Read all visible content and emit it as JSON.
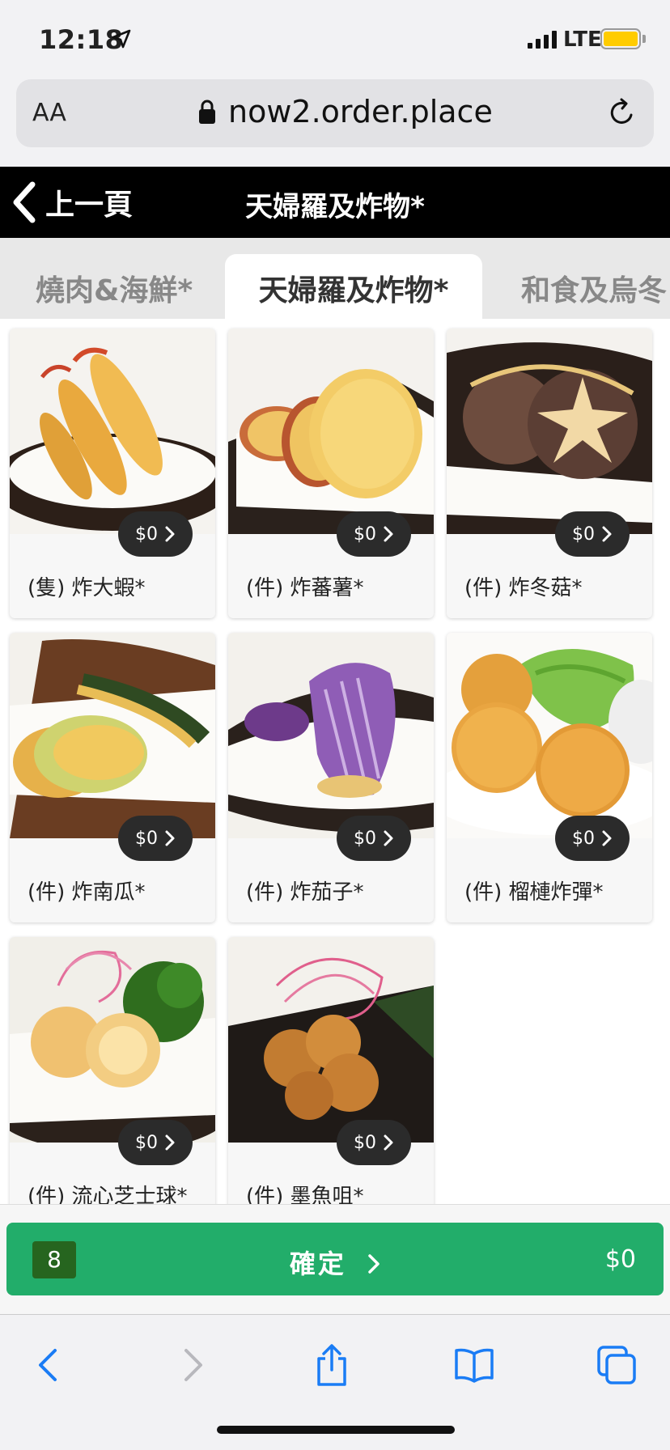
{
  "status_bar": {
    "time": "12:18",
    "network": "LTE"
  },
  "address_bar": {
    "text_size_label": "AA",
    "url": "now2.order.place"
  },
  "nav": {
    "back_label": "上一頁",
    "title": "天婦羅及炸物*"
  },
  "tabs": [
    {
      "label": "燒肉&海鮮*"
    },
    {
      "label": "天婦羅及炸物*",
      "active": true
    },
    {
      "label": "和食及烏冬"
    }
  ],
  "items": [
    {
      "name": "(隻) 炸大蝦*",
      "price": "$0"
    },
    {
      "name": "(件) 炸蕃薯*",
      "price": "$0"
    },
    {
      "name": "(件) 炸冬菇*",
      "price": "$0"
    },
    {
      "name": "(件) 炸南瓜*",
      "price": "$0"
    },
    {
      "name": "(件) 炸茄子*",
      "price": "$0"
    },
    {
      "name": "(件) 榴槤炸彈*",
      "price": "$0"
    },
    {
      "name": "(件) 流心芝士球*",
      "price": "$0"
    },
    {
      "name": "(件) 墨魚咀*",
      "price": "$0"
    }
  ],
  "footer": {
    "count": "8",
    "confirm_label": "確定",
    "total": "$0"
  },
  "colors": {
    "confirm_green": "#22ad6a",
    "badge_green": "#26651f",
    "price_pill": "#2b2b2b",
    "ios_blue": "#1a7cf5"
  }
}
